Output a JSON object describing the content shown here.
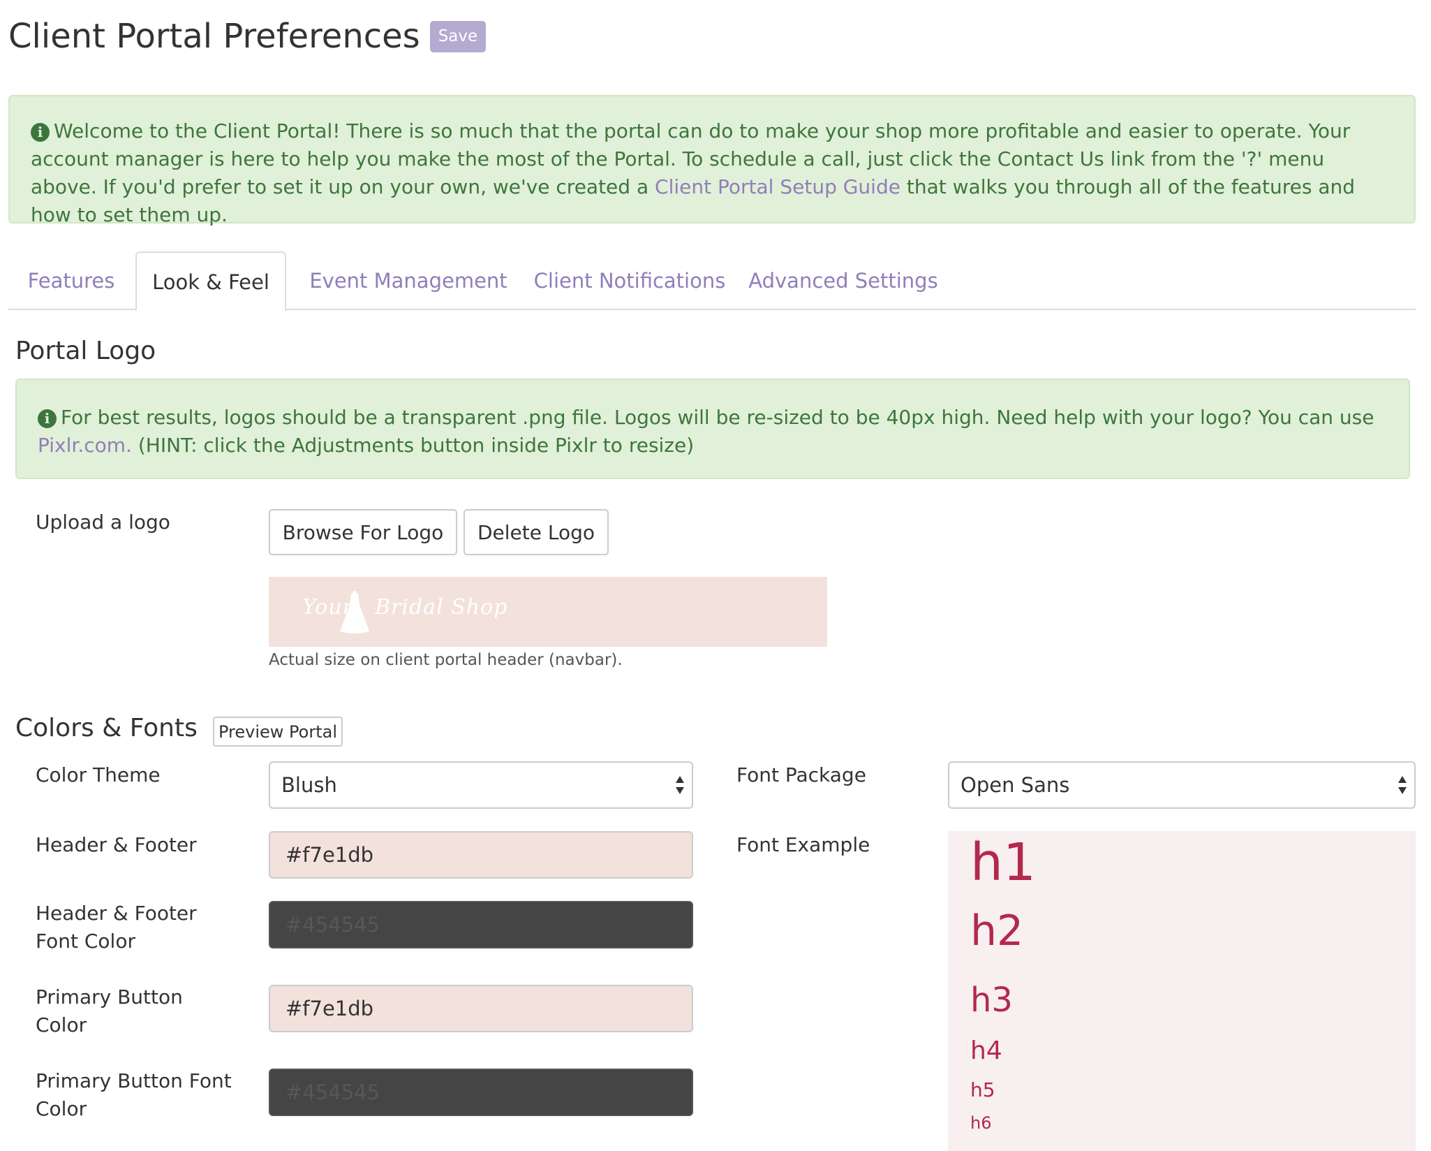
{
  "header": {
    "title": "Client Portal Preferences",
    "save_label": "Save"
  },
  "welcome_alert": {
    "icon": "info-circle-icon",
    "text_before": "Welcome to the Client Portal! There is so much that the portal can do to make your shop more profitable and easier to operate. Your account manager is here to help you make the most of the Portal. To schedule a call, just click the Contact Us link from the '?' menu above. If you'd prefer to set it up on your own, we've created a ",
    "link": "Client Portal Setup Guide",
    "text_after": " that walks you through all of the features and how to set them up."
  },
  "tabs": [
    {
      "label": "Features",
      "active": false
    },
    {
      "label": "Look & Feel",
      "active": true
    },
    {
      "label": "Event Management",
      "active": false
    },
    {
      "label": "Client Notifications",
      "active": false
    },
    {
      "label": "Advanced Settings",
      "active": false
    }
  ],
  "portal_logo": {
    "title": "Portal Logo",
    "alert_before": "For best results, logos should be a transparent .png file. Logos will be re-sized to be 40px high. Need help with your logo? You can use ",
    "alert_link": "Pixlr.com.",
    "alert_after": " (HINT: click the Adjustments button inside Pixlr to resize)",
    "upload_label": "Upload a logo",
    "browse_label": "Browse For Logo",
    "delete_label": "Delete Logo",
    "logo_text_left": "Your",
    "logo_text_right": "Bridal Shop",
    "preview_hint": "Actual size on client portal header (navbar)."
  },
  "colors_fonts": {
    "title": "Colors & Fonts",
    "preview_label": "Preview Portal",
    "color_theme_label": "Color Theme",
    "color_theme_value": "Blush",
    "header_footer_label": "Header & Footer",
    "header_footer_value": "#f7e1db",
    "header_footer_font_label_1": "Header & Footer",
    "header_footer_font_label_2": "Font Color",
    "header_footer_font_value": "#454545",
    "primary_button_label_1": "Primary Button",
    "primary_button_label_2": "Color",
    "primary_button_value": "#f7e1db",
    "primary_button_font_label_1": "Primary Button Font",
    "primary_button_font_label_2": "Color",
    "primary_button_font_value": "#454545",
    "font_package_label": "Font Package",
    "font_package_value": "Open Sans",
    "font_example_label": "Font Example",
    "headings": [
      "h1",
      "h2",
      "h3",
      "h4",
      "h5",
      "h6"
    ]
  },
  "colors": {
    "accent": "#8f7fb9",
    "alert_bg": "#e1f0d8",
    "alert_text": "#3c763d",
    "heading_example": "#b3284d",
    "swatch_light": "#f7e1db",
    "swatch_dark": "#454545"
  }
}
